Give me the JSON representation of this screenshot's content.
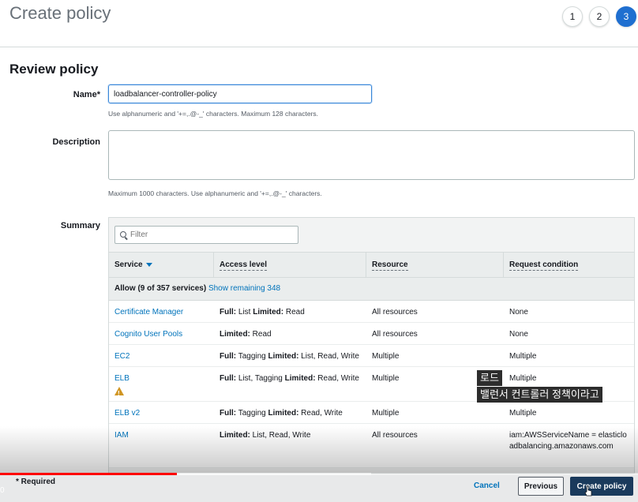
{
  "header": {
    "title": "Create policy",
    "steps": [
      "1",
      "2",
      "3"
    ]
  },
  "review": {
    "section_title": "Review policy",
    "name_label": "Name*",
    "name_value": "loadbalancer-controller-policy",
    "name_hint": "Use alphanumeric and '+=,.@-_' characters. Maximum 128 characters.",
    "description_label": "Description",
    "description_value": "",
    "description_hint": "Maximum 1000 characters. Use alphanumeric and '+=,.@-_' characters.",
    "summary_label": "Summary"
  },
  "summary": {
    "filter_placeholder": "Filter",
    "columns": [
      "Service",
      "Access level",
      "Resource",
      "Request condition"
    ],
    "group_prefix": "Allow (9 of 357 services)",
    "group_link": "Show remaining 348",
    "rows": [
      {
        "service": "Certificate Manager",
        "a1": "Full:",
        "a2": " List ",
        "a3": "Limited:",
        "a4": " Read",
        "resource": "All resources",
        "condition": "None"
      },
      {
        "service": "Cognito User Pools",
        "a1": "",
        "a2": "",
        "a3": "Limited:",
        "a4": " Read",
        "resource": "All resources",
        "condition": "None"
      },
      {
        "service": "EC2",
        "a1": "Full:",
        "a2": " Tagging ",
        "a3": "Limited:",
        "a4": " List, Read, Write",
        "resource": "Multiple",
        "condition": "Multiple"
      },
      {
        "service": "ELB",
        "a1": "Full:",
        "a2": " List, Tagging ",
        "a3": "Limited:",
        "a4": " Read, Write",
        "resource": "Multiple",
        "condition": "Multiple",
        "warning": true
      },
      {
        "service": "ELB v2",
        "a1": "Full:",
        "a2": " Tagging ",
        "a3": "Limited:",
        "a4": " Read, Write",
        "resource": "Multiple",
        "condition": "Multiple"
      },
      {
        "service": "IAM",
        "a1": "",
        "a2": "",
        "a3": "Limited:",
        "a4": " List, Read, Write",
        "resource": "All resources",
        "condition": "iam:AWSServiceName = elasticloadbalancing.amazonaws.com"
      }
    ]
  },
  "footer": {
    "required": "* Required",
    "cancel": "Cancel",
    "previous": "Previous",
    "create": "Create policy"
  },
  "video": {
    "progress": 0.277,
    "buffered": 0.582,
    "time": "0",
    "caption_line1": "로드",
    "caption_line2": "밸런서 컨트롤러 정책이라고"
  },
  "colors": {
    "link": "#0073bb",
    "primary_button": "#1a3a5c",
    "active_step": "#1f6fd0",
    "progress": "#ff0000",
    "warning": "#d09624"
  }
}
